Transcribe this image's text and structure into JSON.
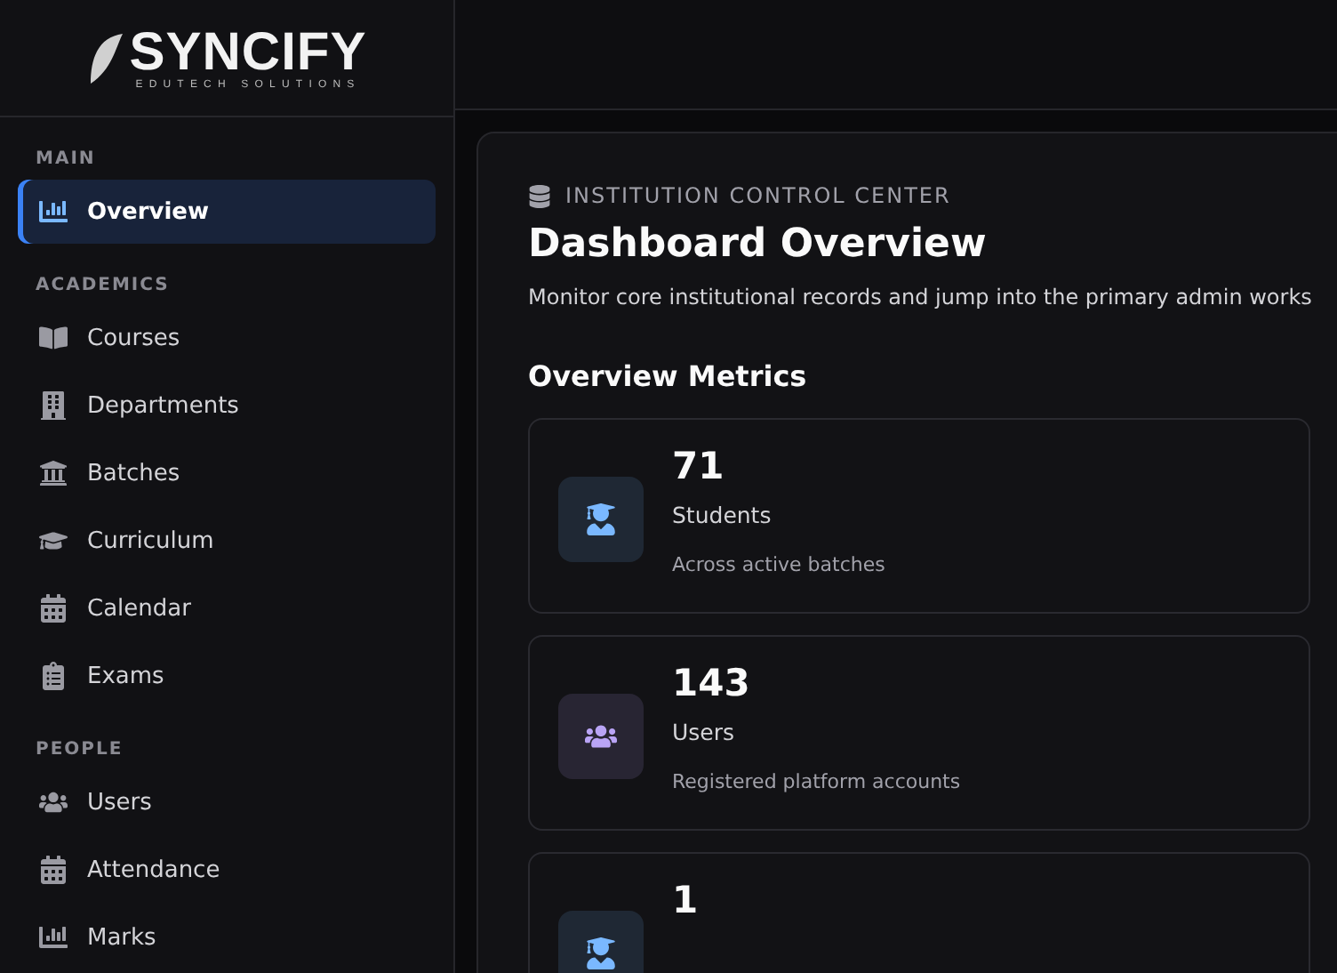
{
  "brand": {
    "name": "SYNCIFY",
    "tagline": "EDUTECH SOLUTIONS"
  },
  "sidebar": {
    "sections": [
      {
        "title": "MAIN",
        "items": [
          {
            "label": "Overview",
            "selected": true
          }
        ]
      },
      {
        "title": "ACADEMICS",
        "items": [
          {
            "label": "Courses",
            "selected": false
          },
          {
            "label": "Departments",
            "selected": false
          },
          {
            "label": "Batches",
            "selected": false
          },
          {
            "label": "Curriculum",
            "selected": false
          },
          {
            "label": "Calendar",
            "selected": false
          },
          {
            "label": "Exams",
            "selected": false
          }
        ]
      },
      {
        "title": "PEOPLE",
        "items": [
          {
            "label": "Users",
            "selected": false
          },
          {
            "label": "Attendance",
            "selected": false
          },
          {
            "label": "Marks",
            "selected": false
          }
        ]
      }
    ]
  },
  "header": {
    "eyebrow": "INSTITUTION CONTROL CENTER",
    "title": "Dashboard Overview",
    "description": "Monitor core institutional records and jump into the primary admin works"
  },
  "metrics": {
    "title": "Overview Metrics",
    "cards": [
      {
        "value": "71",
        "label": "Students",
        "note": "Across active batches",
        "color": "#7ab8ff"
      },
      {
        "value": "143",
        "label": "Users",
        "note": "Registered platform accounts",
        "color": "#b9a4f5"
      },
      {
        "value": "1",
        "color": "#7ab8ff"
      }
    ]
  }
}
